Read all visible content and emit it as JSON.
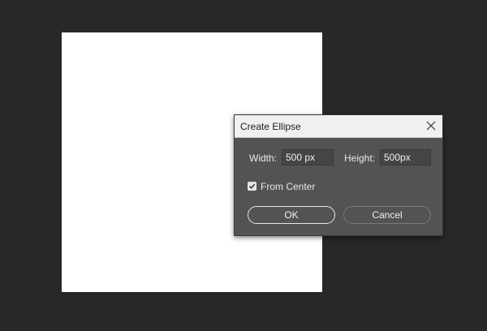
{
  "dialog": {
    "title": "Create Ellipse",
    "width_label": "Width:",
    "width_value": "500 px",
    "height_label": "Height:",
    "height_value": "500px",
    "from_center_label": "From Center",
    "from_center_checked": true,
    "ok_label": "OK",
    "cancel_label": "Cancel"
  },
  "colors": {
    "workspace": "#282828",
    "document": "#ffffff",
    "dialog_body": "#535353",
    "dialog_titlebar": "#f0f0f0"
  },
  "icons": {
    "close": "close-icon",
    "checkbox": "checkmark-icon"
  }
}
